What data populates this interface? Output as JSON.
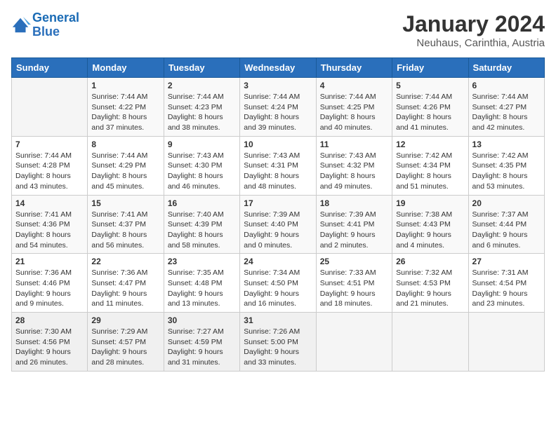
{
  "logo": {
    "line1": "General",
    "line2": "Blue"
  },
  "title": "January 2024",
  "subtitle": "Neuhaus, Carinthia, Austria",
  "days_of_week": [
    "Sunday",
    "Monday",
    "Tuesday",
    "Wednesday",
    "Thursday",
    "Friday",
    "Saturday"
  ],
  "weeks": [
    [
      {
        "num": "",
        "sunrise": "",
        "sunset": "",
        "daylight": ""
      },
      {
        "num": "1",
        "sunrise": "Sunrise: 7:44 AM",
        "sunset": "Sunset: 4:22 PM",
        "daylight": "Daylight: 8 hours and 37 minutes."
      },
      {
        "num": "2",
        "sunrise": "Sunrise: 7:44 AM",
        "sunset": "Sunset: 4:23 PM",
        "daylight": "Daylight: 8 hours and 38 minutes."
      },
      {
        "num": "3",
        "sunrise": "Sunrise: 7:44 AM",
        "sunset": "Sunset: 4:24 PM",
        "daylight": "Daylight: 8 hours and 39 minutes."
      },
      {
        "num": "4",
        "sunrise": "Sunrise: 7:44 AM",
        "sunset": "Sunset: 4:25 PM",
        "daylight": "Daylight: 8 hours and 40 minutes."
      },
      {
        "num": "5",
        "sunrise": "Sunrise: 7:44 AM",
        "sunset": "Sunset: 4:26 PM",
        "daylight": "Daylight: 8 hours and 41 minutes."
      },
      {
        "num": "6",
        "sunrise": "Sunrise: 7:44 AM",
        "sunset": "Sunset: 4:27 PM",
        "daylight": "Daylight: 8 hours and 42 minutes."
      }
    ],
    [
      {
        "num": "7",
        "sunrise": "Sunrise: 7:44 AM",
        "sunset": "Sunset: 4:28 PM",
        "daylight": "Daylight: 8 hours and 43 minutes."
      },
      {
        "num": "8",
        "sunrise": "Sunrise: 7:44 AM",
        "sunset": "Sunset: 4:29 PM",
        "daylight": "Daylight: 8 hours and 45 minutes."
      },
      {
        "num": "9",
        "sunrise": "Sunrise: 7:43 AM",
        "sunset": "Sunset: 4:30 PM",
        "daylight": "Daylight: 8 hours and 46 minutes."
      },
      {
        "num": "10",
        "sunrise": "Sunrise: 7:43 AM",
        "sunset": "Sunset: 4:31 PM",
        "daylight": "Daylight: 8 hours and 48 minutes."
      },
      {
        "num": "11",
        "sunrise": "Sunrise: 7:43 AM",
        "sunset": "Sunset: 4:32 PM",
        "daylight": "Daylight: 8 hours and 49 minutes."
      },
      {
        "num": "12",
        "sunrise": "Sunrise: 7:42 AM",
        "sunset": "Sunset: 4:34 PM",
        "daylight": "Daylight: 8 hours and 51 minutes."
      },
      {
        "num": "13",
        "sunrise": "Sunrise: 7:42 AM",
        "sunset": "Sunset: 4:35 PM",
        "daylight": "Daylight: 8 hours and 53 minutes."
      }
    ],
    [
      {
        "num": "14",
        "sunrise": "Sunrise: 7:41 AM",
        "sunset": "Sunset: 4:36 PM",
        "daylight": "Daylight: 8 hours and 54 minutes."
      },
      {
        "num": "15",
        "sunrise": "Sunrise: 7:41 AM",
        "sunset": "Sunset: 4:37 PM",
        "daylight": "Daylight: 8 hours and 56 minutes."
      },
      {
        "num": "16",
        "sunrise": "Sunrise: 7:40 AM",
        "sunset": "Sunset: 4:39 PM",
        "daylight": "Daylight: 8 hours and 58 minutes."
      },
      {
        "num": "17",
        "sunrise": "Sunrise: 7:39 AM",
        "sunset": "Sunset: 4:40 PM",
        "daylight": "Daylight: 9 hours and 0 minutes."
      },
      {
        "num": "18",
        "sunrise": "Sunrise: 7:39 AM",
        "sunset": "Sunset: 4:41 PM",
        "daylight": "Daylight: 9 hours and 2 minutes."
      },
      {
        "num": "19",
        "sunrise": "Sunrise: 7:38 AM",
        "sunset": "Sunset: 4:43 PM",
        "daylight": "Daylight: 9 hours and 4 minutes."
      },
      {
        "num": "20",
        "sunrise": "Sunrise: 7:37 AM",
        "sunset": "Sunset: 4:44 PM",
        "daylight": "Daylight: 9 hours and 6 minutes."
      }
    ],
    [
      {
        "num": "21",
        "sunrise": "Sunrise: 7:36 AM",
        "sunset": "Sunset: 4:46 PM",
        "daylight": "Daylight: 9 hours and 9 minutes."
      },
      {
        "num": "22",
        "sunrise": "Sunrise: 7:36 AM",
        "sunset": "Sunset: 4:47 PM",
        "daylight": "Daylight: 9 hours and 11 minutes."
      },
      {
        "num": "23",
        "sunrise": "Sunrise: 7:35 AM",
        "sunset": "Sunset: 4:48 PM",
        "daylight": "Daylight: 9 hours and 13 minutes."
      },
      {
        "num": "24",
        "sunrise": "Sunrise: 7:34 AM",
        "sunset": "Sunset: 4:50 PM",
        "daylight": "Daylight: 9 hours and 16 minutes."
      },
      {
        "num": "25",
        "sunrise": "Sunrise: 7:33 AM",
        "sunset": "Sunset: 4:51 PM",
        "daylight": "Daylight: 9 hours and 18 minutes."
      },
      {
        "num": "26",
        "sunrise": "Sunrise: 7:32 AM",
        "sunset": "Sunset: 4:53 PM",
        "daylight": "Daylight: 9 hours and 21 minutes."
      },
      {
        "num": "27",
        "sunrise": "Sunrise: 7:31 AM",
        "sunset": "Sunset: 4:54 PM",
        "daylight": "Daylight: 9 hours and 23 minutes."
      }
    ],
    [
      {
        "num": "28",
        "sunrise": "Sunrise: 7:30 AM",
        "sunset": "Sunset: 4:56 PM",
        "daylight": "Daylight: 9 hours and 26 minutes."
      },
      {
        "num": "29",
        "sunrise": "Sunrise: 7:29 AM",
        "sunset": "Sunset: 4:57 PM",
        "daylight": "Daylight: 9 hours and 28 minutes."
      },
      {
        "num": "30",
        "sunrise": "Sunrise: 7:27 AM",
        "sunset": "Sunset: 4:59 PM",
        "daylight": "Daylight: 9 hours and 31 minutes."
      },
      {
        "num": "31",
        "sunrise": "Sunrise: 7:26 AM",
        "sunset": "Sunset: 5:00 PM",
        "daylight": "Daylight: 9 hours and 33 minutes."
      },
      {
        "num": "",
        "sunrise": "",
        "sunset": "",
        "daylight": ""
      },
      {
        "num": "",
        "sunrise": "",
        "sunset": "",
        "daylight": ""
      },
      {
        "num": "",
        "sunrise": "",
        "sunset": "",
        "daylight": ""
      }
    ]
  ]
}
